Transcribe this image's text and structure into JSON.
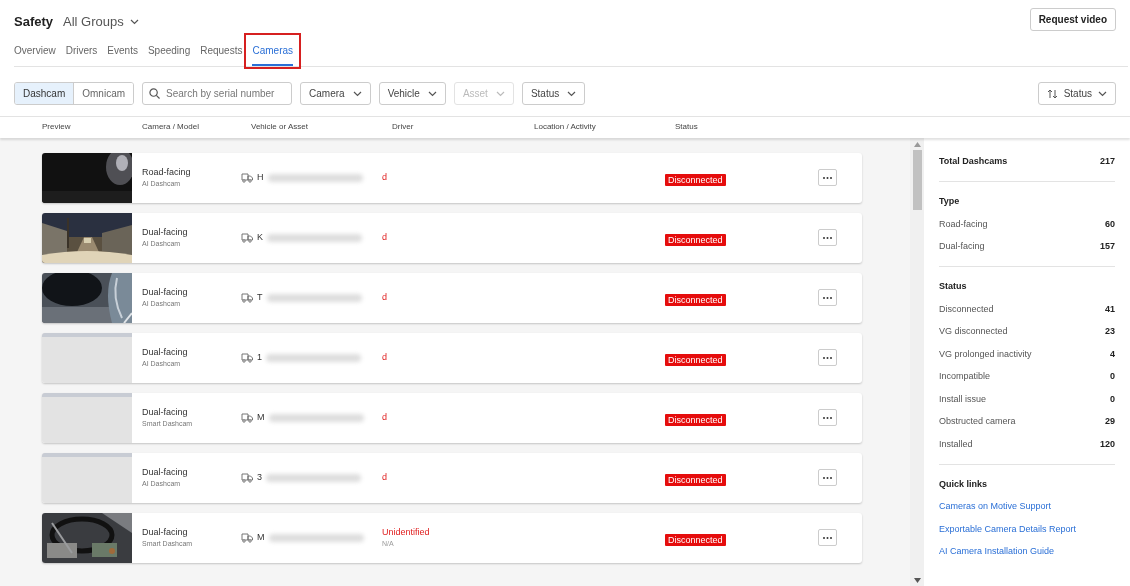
{
  "header": {
    "title": "Safety",
    "group": "All Groups",
    "action": "Request video"
  },
  "tabs": [
    {
      "label": "Overview",
      "selected": false,
      "highlighted": false
    },
    {
      "label": "Drivers",
      "selected": false,
      "highlighted": false
    },
    {
      "label": "Events",
      "selected": false,
      "highlighted": false
    },
    {
      "label": "Speeding",
      "selected": false,
      "highlighted": false
    },
    {
      "label": "Requests",
      "selected": false,
      "highlighted": false
    },
    {
      "label": "Cameras",
      "selected": true,
      "highlighted": true
    }
  ],
  "toolbar": {
    "segments": [
      {
        "label": "Dashcam",
        "selected": true
      },
      {
        "label": "Omnicam",
        "selected": false
      }
    ],
    "search": {
      "placeholder": "Search by serial number"
    },
    "filters": [
      {
        "label": "Camera",
        "disabled": false
      },
      {
        "label": "Vehicle",
        "disabled": false
      },
      {
        "label": "Asset",
        "disabled": true
      },
      {
        "label": "Status",
        "disabled": false
      }
    ],
    "sort": "Status"
  },
  "table": {
    "columns": [
      "Preview",
      "Camera / Model",
      "Vehicle or Asset",
      "Driver",
      "Location / Activity",
      "Status"
    ],
    "rows": [
      {
        "camera": "Road-facing",
        "model": "AI Dashcam",
        "vehicle": "H",
        "driver": "d",
        "status": "Disconnected"
      },
      {
        "camera": "Dual-facing",
        "model": "AI Dashcam",
        "vehicle": "K",
        "driver": "d",
        "status": "Disconnected"
      },
      {
        "camera": "Dual-facing",
        "model": "AI Dashcam",
        "vehicle": "T",
        "driver": "d",
        "status": "Disconnected"
      },
      {
        "preview": {
          "kind": "placeholder"
        },
        "camera": "Dual-facing",
        "model": "AI Dashcam",
        "vehicle": "1",
        "driver": "d",
        "status": "Disconnected"
      },
      {
        "preview": {
          "kind": "placeholder"
        },
        "camera": "Dual-facing",
        "model": "Smart Dashcam",
        "vehicle": "M",
        "driver": "d",
        "status": "Disconnected"
      },
      {
        "preview": {
          "kind": "placeholder"
        },
        "camera": "Dual-facing",
        "model": "AI Dashcam",
        "vehicle": "3",
        "driver": "d",
        "status": "Disconnected"
      },
      {
        "camera": "Dual-facing",
        "model": "Smart Dashcam",
        "vehicle": "M",
        "driver": "Unidentified",
        "driver_detail": "N/A",
        "status": "Disconnected"
      }
    ]
  },
  "summary": {
    "total": {
      "label": "Total Dashcams",
      "value": "217"
    },
    "sections": [
      {
        "title": "Type",
        "items": [
          {
            "label": "Road-facing",
            "value": "60"
          },
          {
            "label": "Dual-facing",
            "value": "157"
          }
        ]
      },
      {
        "title": "Status",
        "items": [
          {
            "label": "Disconnected",
            "value": "41"
          },
          {
            "label": "VG disconnected",
            "value": "23"
          },
          {
            "label": "VG prolonged inactivity",
            "value": "4"
          },
          {
            "label": "Incompatible",
            "value": "0"
          },
          {
            "label": "Install issue",
            "value": "0"
          },
          {
            "label": "Obstructed camera",
            "value": "29"
          },
          {
            "label": "Installed",
            "value": "120"
          }
        ]
      }
    ],
    "quick_links": {
      "title": "Quick links",
      "links": [
        "Cameras on Motive Support",
        "Exportable Camera Details Report",
        "AI Camera Installation Guide"
      ]
    }
  }
}
